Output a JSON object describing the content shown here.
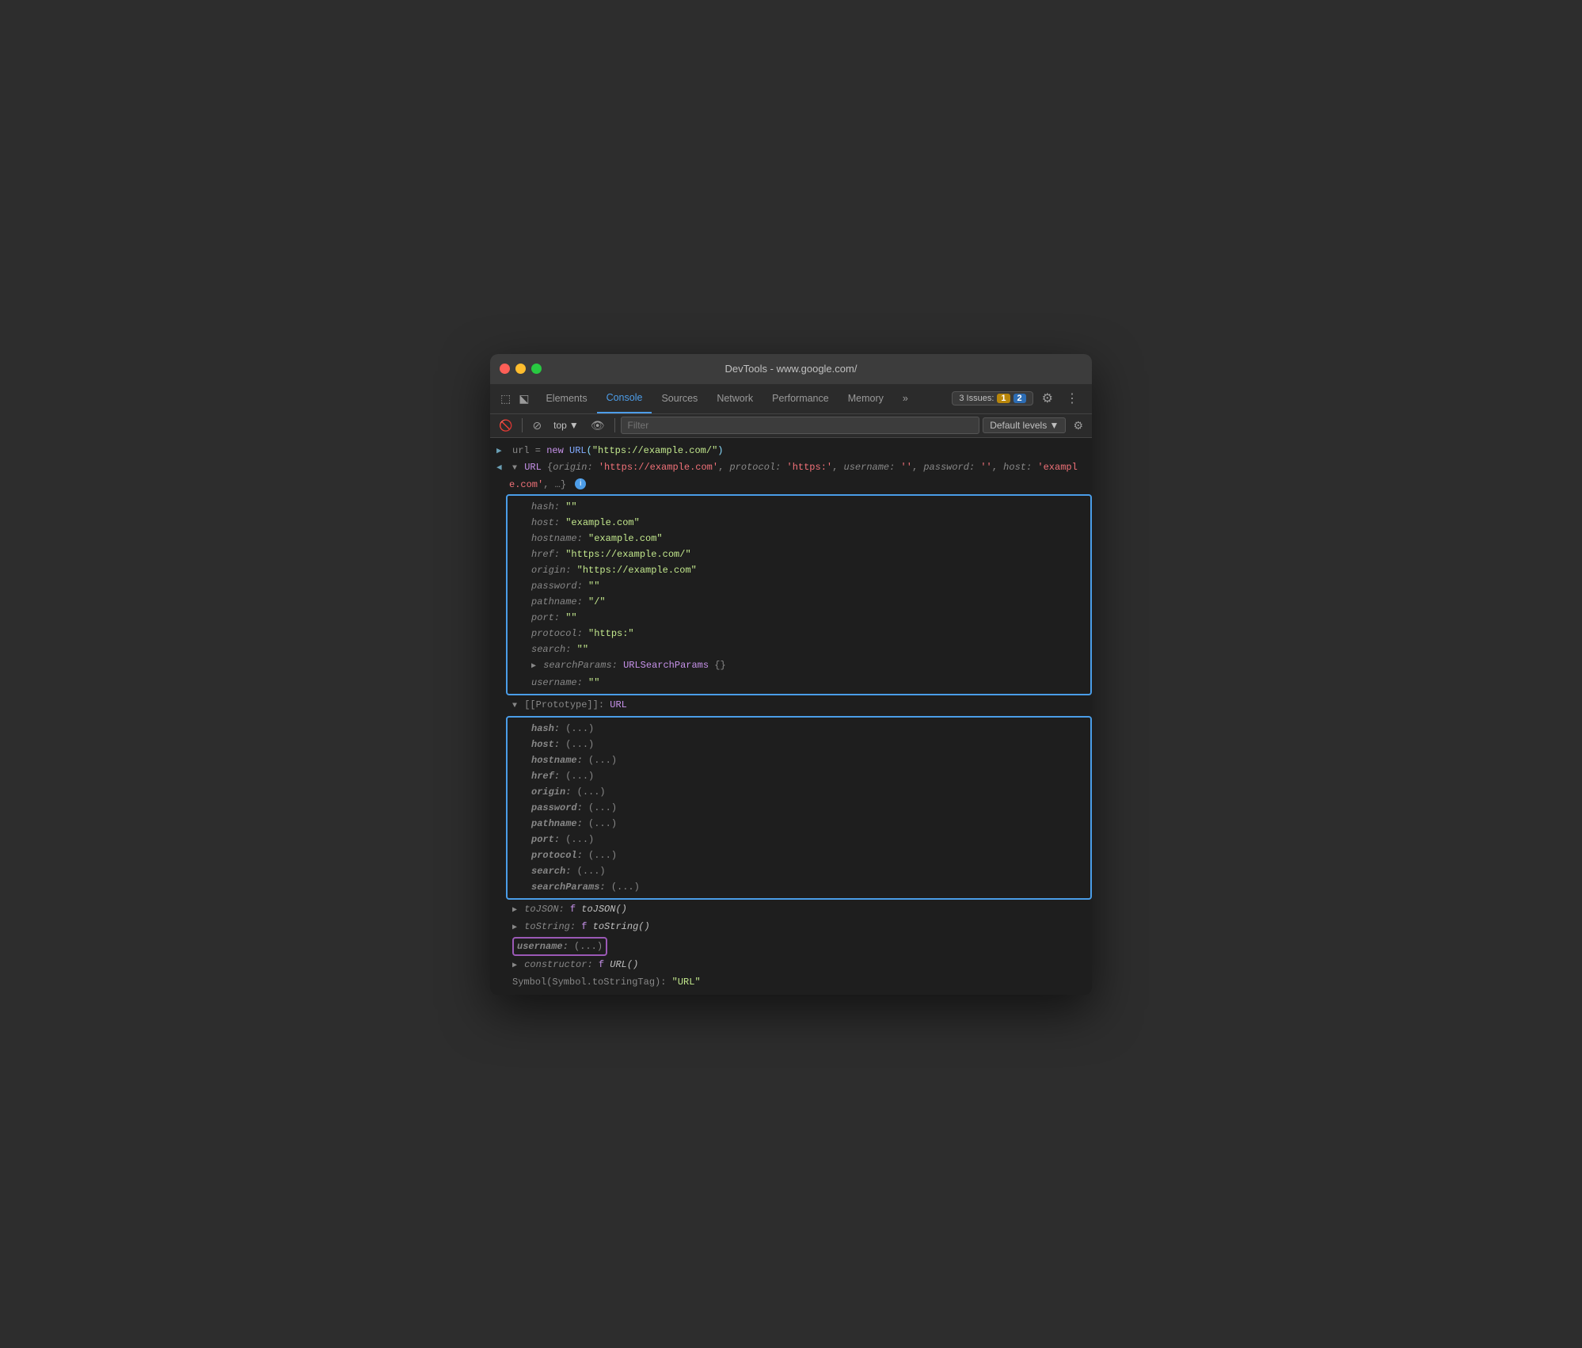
{
  "window": {
    "title": "DevTools - www.google.com/"
  },
  "tabs": {
    "items": [
      {
        "label": "Elements",
        "active": false
      },
      {
        "label": "Console",
        "active": true
      },
      {
        "label": "Sources",
        "active": false
      },
      {
        "label": "Network",
        "active": false
      },
      {
        "label": "Performance",
        "active": false
      },
      {
        "label": "Memory",
        "active": false
      }
    ],
    "more_label": "»"
  },
  "toolbar": {
    "top_label": "top",
    "filter_placeholder": "Filter",
    "levels_label": "Default levels ▼",
    "issues_label": "3 Issues:",
    "warn_count": "1",
    "info_count": "2"
  },
  "console": {
    "line1": "url = new URL(\"https://example.com/\")",
    "url_header": "▼ URL {origin: 'https://example.com', protocol: 'https:', username: '', password: '', host: 'exampl",
    "url_header2": "e.com', …}",
    "props": {
      "hash": "hash: \"\"",
      "host": "host: \"example.com\"",
      "hostname": "hostname: \"example.com\"",
      "href": "href: \"https://example.com/\"",
      "origin": "origin: \"https://example.com\"",
      "password": "password: \"\"",
      "pathname": "pathname: \"/\"",
      "port": "port: \"\"",
      "protocol": "protocol: \"https:\"",
      "search": "search: \"\"",
      "searchParams": "searchParams: URLSearchParams {}",
      "username": "username: \"\""
    },
    "prototype": {
      "header": "▼ [[Prototype]]: URL",
      "hash": "hash: (...)",
      "host": "host: (...)",
      "hostname": "hostname: (...)",
      "href": "href: (...)",
      "origin": "origin: (...)",
      "password": "password: (...)",
      "pathname": "pathname: (...)",
      "port": "port: (...)",
      "protocol": "protocol: (...)",
      "search": "search: (...)",
      "searchParams": "searchParams: (...)"
    },
    "toJSON": "▶ toJSON: f toJSON()",
    "toString": "▶ toString: f toString()",
    "username_proto": "username: (...)",
    "constructor": "▶ constructor: f URL()",
    "symbol": "Symbol(Symbol.toStringTag): \"URL\""
  }
}
